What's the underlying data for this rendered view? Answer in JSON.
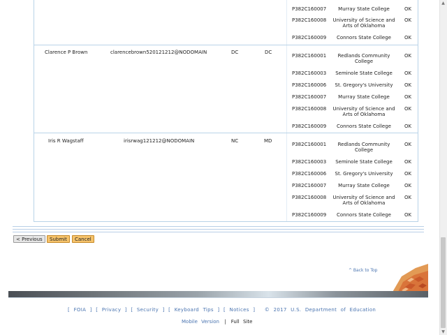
{
  "colleges": {
    "redlands": "Redlands Community College",
    "seminole": "Seminole State College",
    "stgregory": "St. Gregory's University",
    "murray": "Murray State College",
    "usao": "University of Science and Arts of Oklahoma",
    "connors": "Connors State College"
  },
  "top_rows": [
    {
      "code": "P382C160007",
      "college": "Murray State College",
      "status": "OK"
    },
    {
      "code": "P382C160008",
      "college": "University of Science and Arts of Oklahoma",
      "status": "OK"
    },
    {
      "code": "P382C160009",
      "college": "Connors State College",
      "status": "OK"
    }
  ],
  "people": [
    {
      "name": "Clarence P Brown",
      "email": "clarencebrown520121212@NODOMAIN",
      "state1": "DC",
      "state2": "DC",
      "rows": [
        {
          "code": "P382C160001",
          "college": "Redlands Community College",
          "status": "OK"
        },
        {
          "code": "P382C160003",
          "college": "Seminole State College",
          "status": "OK"
        },
        {
          "code": "P382C160006",
          "college": "St. Gregory's University",
          "status": "OK"
        },
        {
          "code": "P382C160007",
          "college": "Murray State College",
          "status": "OK"
        },
        {
          "code": "P382C160008",
          "college": "University of Science and Arts of Oklahoma",
          "status": "OK"
        },
        {
          "code": "P382C160009",
          "college": "Connors State College",
          "status": "OK"
        }
      ]
    },
    {
      "name": "Iris R Wagstaff",
      "email": "irisrwag121212@NODOMAIN",
      "state1": "NC",
      "state2": "MD",
      "rows": [
        {
          "code": "P382C160001",
          "college": "Redlands Community College",
          "status": "OK"
        },
        {
          "code": "P382C160003",
          "college": "Seminole State College",
          "status": "OK"
        },
        {
          "code": "P382C160006",
          "college": "St. Gregory's University",
          "status": "OK"
        },
        {
          "code": "P382C160007",
          "college": "Murray State College",
          "status": "OK"
        },
        {
          "code": "P382C160008",
          "college": "University of Science and Arts of Oklahoma",
          "status": "OK"
        },
        {
          "code": "P382C160009",
          "college": "Connors State College",
          "status": "OK"
        }
      ]
    }
  ],
  "buttons": {
    "previous": "< Previous",
    "submit": "Submit",
    "cancel": "Cancel"
  },
  "back_to_top": "^ Back to Top",
  "footer": {
    "foia": "FOIA",
    "privacy": "Privacy",
    "security": "Security",
    "keyboard": "Keyboard Tips",
    "notices": "Notices",
    "copyright": "© 2017 U.S. Department of Education",
    "mobile": "Mobile Version",
    "sep": "|",
    "full": "Full Site"
  },
  "colors": {
    "link": "#4a74b0",
    "accent_orange": "#f6c36b",
    "table_rule": "#b9d3e8"
  }
}
